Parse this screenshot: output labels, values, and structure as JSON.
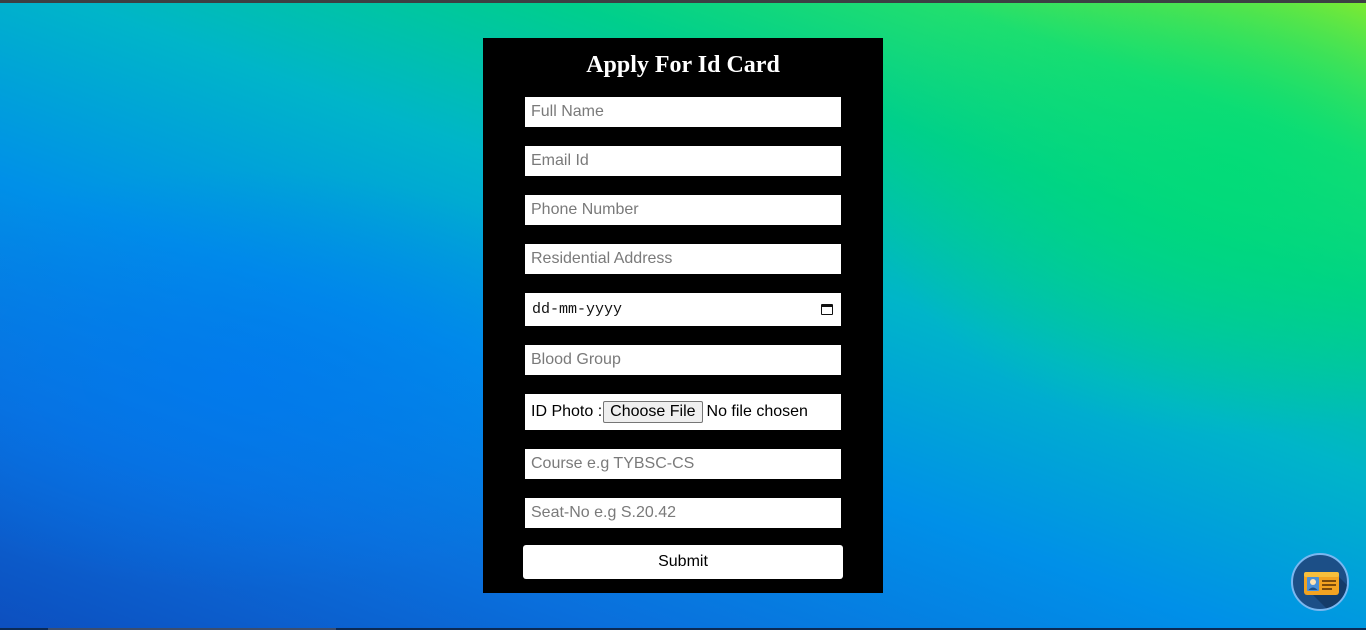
{
  "form": {
    "title": "Apply For Id Card",
    "fields": {
      "full_name": {
        "placeholder": "Full Name"
      },
      "email": {
        "placeholder": "Email Id"
      },
      "phone": {
        "placeholder": "Phone Number"
      },
      "address": {
        "placeholder": "Residential Address"
      },
      "dob": {
        "display": "dd-mm-yyyy"
      },
      "blood_group": {
        "placeholder": "Blood Group"
      },
      "id_photo": {
        "label": "ID Photo :",
        "button_label": "Choose File",
        "status": "No file chosen"
      },
      "course": {
        "placeholder": "Course e.g TYBSC-CS"
      },
      "seat_no": {
        "placeholder": "Seat-No e.g S.20.42"
      }
    },
    "submit_label": "Submit"
  },
  "floating_button": {
    "icon": "id-card-icon"
  },
  "colors": {
    "card_background": "#000000",
    "gradient_top_right": "#a4ee1c",
    "gradient_bottom_left": "#0d4fbf"
  }
}
